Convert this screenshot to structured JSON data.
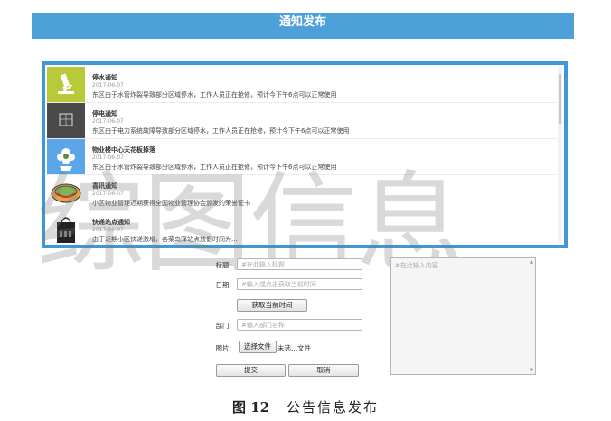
{
  "header": {
    "title": "通知发布"
  },
  "notices": [
    {
      "icon": "microscope-icon",
      "title": "停水通知",
      "date": "2017-06-07",
      "content": "东区由于水管炸裂导致部分区域停水，工作人员正在抢修，预计今下午6点可以正常使用"
    },
    {
      "icon": "blueprint-icon",
      "title": "停电通知",
      "date": "2017-06-07",
      "content": "东区由于电力系统故障导致部分区域停水，工作人员正在抢修，预计今下午6点可以正常使用"
    },
    {
      "icon": "flower-icon",
      "title": "物业楼中心天花板掉落",
      "date": "2017-06-07",
      "content": "东区由于水管炸裂导致部分区域停水，工作人员正在抢修，预计今下午6点可以正常使用"
    },
    {
      "icon": "trophy-icon",
      "title": "喜讯通知",
      "date": "2017-06-07",
      "content": "小区物业管理近期获得全国物业管理协会颁发的荣誉证书"
    },
    {
      "icon": "tote-bag-icon",
      "title": "快递站点通知",
      "date": "2017-06-07",
      "content": "由于近期小区快递激增，各菜鸟驿站点放假时间为..."
    }
  ],
  "form": {
    "title_label": "标题:",
    "title_placeholder": "#在此输入标题",
    "date_label": "日期:",
    "date_placeholder": "#输入或点击获取当前时间",
    "get_time_button": "获取当前时间",
    "dept_label": "部门:",
    "dept_placeholder": "#输入部门名称",
    "image_label": "图片:",
    "choose_file_button": "选择文件",
    "file_status": "未选...文件",
    "content_placeholder": "#在此输入内容",
    "submit_button": "提交",
    "cancel_button": "取消"
  },
  "caption": {
    "figure": "图 12",
    "text": "公告信息发布"
  },
  "watermark": "综图信息",
  "colors": {
    "header": "#4ea0d8",
    "list_border": "#3f97d6"
  }
}
